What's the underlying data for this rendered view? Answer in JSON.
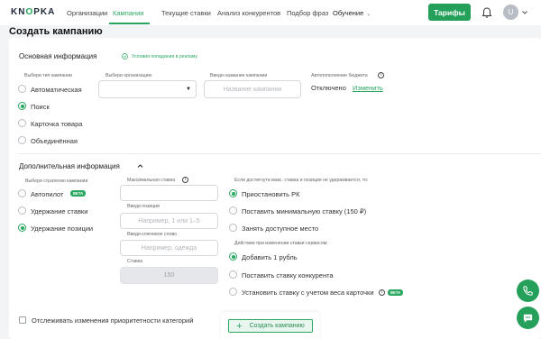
{
  "logo": {
    "text_pre": "KN",
    "text_o": "O",
    "text_post": "PKA"
  },
  "nav": {
    "items": [
      "Организации",
      "Кампании",
      "Текущие ставки",
      "Анализ конкурентов",
      "Подбор фраз",
      "Обучение"
    ],
    "active": "Кампании"
  },
  "header": {
    "tariffs_label": "Тарифы",
    "avatar_letter": "U"
  },
  "page": {
    "title": "Создать кампанию"
  },
  "basic": {
    "title": "Основная информация",
    "conditions_link": "Условия попадания в рекламу",
    "type_label": "Выбери тип кампании",
    "types": [
      "Автоматическая",
      "Поиск",
      "Карточка товара",
      "Объединённая"
    ],
    "selected_type": "Поиск",
    "org_label": "Выбери организацию",
    "org_value": "",
    "name_label": "Введи название кампании",
    "name_placeholder": "Название кампании",
    "budget_label": "Автопополнение бюджета",
    "budget_status": "Отключено",
    "budget_change": "Изменить"
  },
  "extra": {
    "title": "Дополнительная информация",
    "strategy_label": "Выбери стратегию кампании",
    "strategies": [
      "Автопилот",
      "Удержание ставки",
      "Удержание позиции"
    ],
    "autopilot_badge": "BETA",
    "selected_strategy": "Удержание позиции",
    "max_bid_label": "Максимальная ставка",
    "max_bid_value": "",
    "position_label": "Введи позиции",
    "position_placeholder": "Например, 1 или 1–5",
    "keyword_label": "Введи ключевое слово",
    "keyword_placeholder": "Например, одежда",
    "bid_label": "Ставка",
    "bid_value": "150",
    "limit_label": "Если достигнута макс. ставка и позиция не удерживается, то:",
    "limit_options": [
      "Приостановить РК",
      "Поставить минимальную ставку (150 ₽)",
      "Занять доступное место"
    ],
    "selected_limit": "Приостановить РК",
    "change_label": "Действие при изменении ставки сервисом:",
    "change_options": [
      "Добавить 1 рубль",
      "Поставить ставку конкурента",
      "Установить ставку с учетом веса карточки"
    ],
    "weight_badge": "BETA",
    "selected_change": "Добавить 1 рубль",
    "track_label": "Отслеживать изменения приоритетности категорий",
    "track_checked": false
  },
  "actions": {
    "create_label": "Создать кампанию"
  },
  "colors": {
    "accent": "#24a05a",
    "background": "#f3f4f6"
  }
}
